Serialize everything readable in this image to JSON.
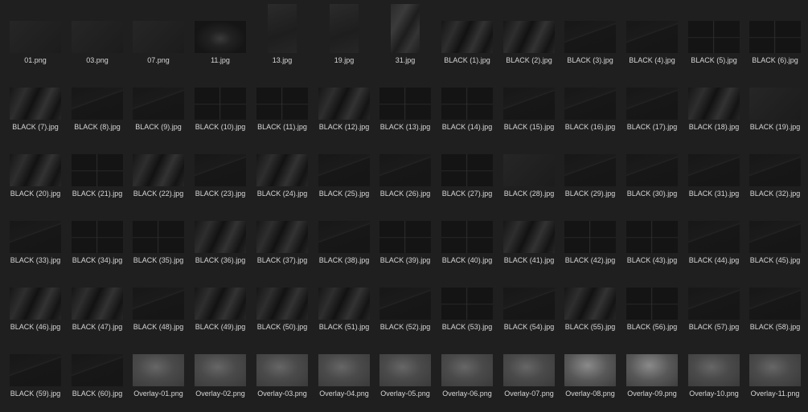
{
  "files": [
    {
      "name": "01.png",
      "thumb": "plain-dark"
    },
    {
      "name": "03.png",
      "thumb": "plain-dark"
    },
    {
      "name": "07.png",
      "thumb": "plain-dark"
    },
    {
      "name": "11.jpg",
      "thumb": "speckle"
    },
    {
      "name": "13.jpg",
      "thumb": "portrait"
    },
    {
      "name": "19.jpg",
      "thumb": "portrait"
    },
    {
      "name": "31.jpg",
      "thumb": "portrait-crumpled"
    },
    {
      "name": "BLACK (1).jpg",
      "thumb": "crumpled"
    },
    {
      "name": "BLACK (2).jpg",
      "thumb": "crumpled"
    },
    {
      "name": "BLACK (3).jpg",
      "thumb": "scratched"
    },
    {
      "name": "BLACK (4).jpg",
      "thumb": "scratched"
    },
    {
      "name": "BLACK (5).jpg",
      "thumb": "folded"
    },
    {
      "name": "BLACK (6).jpg",
      "thumb": "folded"
    },
    {
      "name": "BLACK (7).jpg",
      "thumb": "crumpled"
    },
    {
      "name": "BLACK (8).jpg",
      "thumb": "scratched"
    },
    {
      "name": "BLACK (9).jpg",
      "thumb": "scratched"
    },
    {
      "name": "BLACK (10).jpg",
      "thumb": "folded"
    },
    {
      "name": "BLACK (11).jpg",
      "thumb": "folded"
    },
    {
      "name": "BLACK (12).jpg",
      "thumb": "crumpled"
    },
    {
      "name": "BLACK (13).jpg",
      "thumb": "folded"
    },
    {
      "name": "BLACK (14).jpg",
      "thumb": "folded"
    },
    {
      "name": "BLACK (15).jpg",
      "thumb": "scratched"
    },
    {
      "name": "BLACK (16).jpg",
      "thumb": "scratched"
    },
    {
      "name": "BLACK (17).jpg",
      "thumb": "scratched"
    },
    {
      "name": "BLACK (18).jpg",
      "thumb": "crumpled"
    },
    {
      "name": "BLACK (19).jpg",
      "thumb": "plain-dark"
    },
    {
      "name": "BLACK (20).jpg",
      "thumb": "crumpled"
    },
    {
      "name": "BLACK (21).jpg",
      "thumb": "folded"
    },
    {
      "name": "BLACK (22).jpg",
      "thumb": "crumpled"
    },
    {
      "name": "BLACK (23).jpg",
      "thumb": "scratched"
    },
    {
      "name": "BLACK (24).jpg",
      "thumb": "crumpled"
    },
    {
      "name": "BLACK (25).jpg",
      "thumb": "scratched"
    },
    {
      "name": "BLACK (26).jpg",
      "thumb": "scratched"
    },
    {
      "name": "BLACK (27).jpg",
      "thumb": "folded"
    },
    {
      "name": "BLACK (28).jpg",
      "thumb": "plain-dark"
    },
    {
      "name": "BLACK (29).jpg",
      "thumb": "scratched"
    },
    {
      "name": "BLACK (30).jpg",
      "thumb": "scratched"
    },
    {
      "name": "BLACK (31).jpg",
      "thumb": "scratched"
    },
    {
      "name": "BLACK (32).jpg",
      "thumb": "scratched"
    },
    {
      "name": "BLACK (33).jpg",
      "thumb": "scratched"
    },
    {
      "name": "BLACK (34).jpg",
      "thumb": "folded"
    },
    {
      "name": "BLACK (35).jpg",
      "thumb": "folded"
    },
    {
      "name": "BLACK (36).jpg",
      "thumb": "crumpled"
    },
    {
      "name": "BLACK (37).jpg",
      "thumb": "crumpled"
    },
    {
      "name": "BLACK (38).jpg",
      "thumb": "scratched"
    },
    {
      "name": "BLACK (39).jpg",
      "thumb": "folded"
    },
    {
      "name": "BLACK (40).jpg",
      "thumb": "folded"
    },
    {
      "name": "BLACK (41).jpg",
      "thumb": "crumpled"
    },
    {
      "name": "BLACK (42).jpg",
      "thumb": "folded"
    },
    {
      "name": "BLACK (43).jpg",
      "thumb": "folded"
    },
    {
      "name": "BLACK (44).jpg",
      "thumb": "scratched"
    },
    {
      "name": "BLACK (45).jpg",
      "thumb": "scratched"
    },
    {
      "name": "BLACK (46).jpg",
      "thumb": "crumpled"
    },
    {
      "name": "BLACK (47).jpg",
      "thumb": "crumpled"
    },
    {
      "name": "BLACK (48).jpg",
      "thumb": "scratched"
    },
    {
      "name": "BLACK (49).jpg",
      "thumb": "crumpled"
    },
    {
      "name": "BLACK (50).jpg",
      "thumb": "crumpled"
    },
    {
      "name": "BLACK (51).jpg",
      "thumb": "crumpled"
    },
    {
      "name": "BLACK (52).jpg",
      "thumb": "scratched"
    },
    {
      "name": "BLACK (53).jpg",
      "thumb": "folded"
    },
    {
      "name": "BLACK (54).jpg",
      "thumb": "scratched"
    },
    {
      "name": "BLACK (55).jpg",
      "thumb": "crumpled"
    },
    {
      "name": "BLACK (56).jpg",
      "thumb": "folded"
    },
    {
      "name": "BLACK (57).jpg",
      "thumb": "scratched"
    },
    {
      "name": "BLACK (58).jpg",
      "thumb": "scratched"
    },
    {
      "name": "BLACK (59).jpg",
      "thumb": "scratched"
    },
    {
      "name": "BLACK (60).jpg",
      "thumb": "scratched"
    },
    {
      "name": "Overlay-01.png",
      "thumb": "overlay"
    },
    {
      "name": "Overlay-02.png",
      "thumb": "overlay"
    },
    {
      "name": "Overlay-03.png",
      "thumb": "overlay"
    },
    {
      "name": "Overlay-04.png",
      "thumb": "overlay"
    },
    {
      "name": "Overlay-05.png",
      "thumb": "overlay"
    },
    {
      "name": "Overlay-06.png",
      "thumb": "overlay"
    },
    {
      "name": "Overlay-07.png",
      "thumb": "overlay"
    },
    {
      "name": "Overlay-08.png",
      "thumb": "overlay-bright"
    },
    {
      "name": "Overlay-09.png",
      "thumb": "overlay-bright"
    },
    {
      "name": "Overlay-10.png",
      "thumb": "overlay"
    },
    {
      "name": "Overlay-11.png",
      "thumb": "overlay"
    }
  ],
  "colors": {
    "background": "#1f1f1f",
    "label_text": "#d6d6d6"
  }
}
